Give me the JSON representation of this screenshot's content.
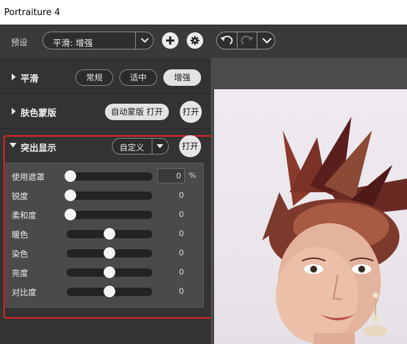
{
  "window": {
    "title": "Portraiture 4"
  },
  "toolbar": {
    "preset_label": "预设",
    "preset_value": "平滑: 增强",
    "add_icon": "plus-icon",
    "settings_icon": "gear-icon",
    "undo_icon": "undo-icon",
    "redo_icon": "redo-icon",
    "history_icon": "chevron-down-icon"
  },
  "smoothing": {
    "title": "平滑",
    "options": [
      "常规",
      "适中",
      "增强"
    ],
    "selected": "增强"
  },
  "skin_mask": {
    "title": "肤色蒙版",
    "auto_mask_button": "自动蒙版 打开",
    "open_button": "打开"
  },
  "enhance": {
    "title": "突出显示",
    "mode_value": "自定义",
    "open_button": "打开",
    "sliders": [
      {
        "label": "使用遮罩",
        "value": "0",
        "unit": "%",
        "level": 0
      },
      {
        "label": "锐度",
        "value": "0",
        "level": 0
      },
      {
        "label": "柔和度",
        "value": "0",
        "level": 0
      },
      {
        "label": "暖色",
        "value": "0",
        "level": 0.5
      },
      {
        "label": "染色",
        "value": "0",
        "level": 0.5
      },
      {
        "label": "亮度",
        "value": "0",
        "level": 0.5
      },
      {
        "label": "对比度",
        "value": "0",
        "level": 0.5
      }
    ]
  },
  "colors": {
    "accent_highlight": "#e8231f",
    "panel_bg": "#333333",
    "slider_box_bg": "#4a4a4a"
  }
}
